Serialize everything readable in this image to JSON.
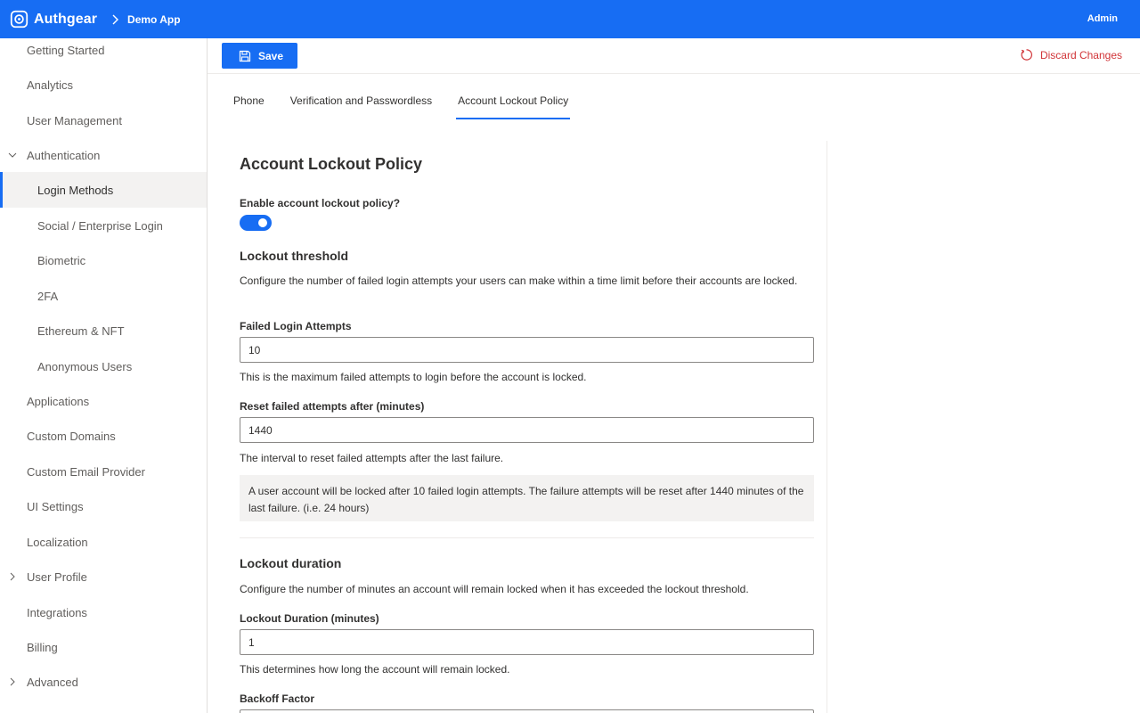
{
  "topbar": {
    "brand": "Authgear",
    "app": "Demo App",
    "user": "Admin"
  },
  "sidebar": {
    "items": [
      {
        "label": "Getting Started"
      },
      {
        "label": "Analytics"
      },
      {
        "label": "User Management"
      },
      {
        "label": "Authentication",
        "expanded": true
      },
      {
        "label": "Login Methods",
        "active": true
      },
      {
        "label": "Social / Enterprise Login"
      },
      {
        "label": "Biometric"
      },
      {
        "label": "2FA"
      },
      {
        "label": "Ethereum & NFT"
      },
      {
        "label": "Anonymous Users"
      },
      {
        "label": "Applications"
      },
      {
        "label": "Custom Domains"
      },
      {
        "label": "Custom Email Provider"
      },
      {
        "label": "UI Settings"
      },
      {
        "label": "Localization"
      },
      {
        "label": "User Profile",
        "expandable": true
      },
      {
        "label": "Integrations"
      },
      {
        "label": "Billing"
      },
      {
        "label": "Advanced",
        "expandable": true
      }
    ]
  },
  "toolbar": {
    "save_label": "Save",
    "discard_label": "Discard Changes"
  },
  "tabs": [
    {
      "label": "Phone"
    },
    {
      "label": "Verification and Passwordless"
    },
    {
      "label": "Account Lockout Policy",
      "active": true
    }
  ],
  "main": {
    "title": "Account Lockout Policy",
    "enable_label": "Enable account lockout policy?",
    "enable_value": true,
    "threshold": {
      "title": "Lockout threshold",
      "description": "Configure the number of failed login attempts your users can make within a time limit before their accounts are locked.",
      "attempts_label": "Failed Login Attempts",
      "attempts_value": "10",
      "attempts_help": "This is the maximum failed attempts to login before the account is locked.",
      "reset_label": "Reset failed attempts after (minutes)",
      "reset_value": "1440",
      "reset_help": "The interval to reset failed attempts after the last failure.",
      "summary": "A user account will be locked after 10 failed login attempts. The failure attempts will be reset after 1440 minutes of the last failure. (i.e. 24 hours)"
    },
    "duration": {
      "title": "Lockout duration",
      "description": "Configure the number of minutes an account will remain locked when it has exceeded the lockout threshold.",
      "duration_label": "Lockout Duration (minutes)",
      "duration_value": "1",
      "duration_help": "This determines how long the account will remain locked.",
      "backoff_label": "Backoff Factor"
    }
  },
  "colors": {
    "brand": "#176df3",
    "danger": "#d13438",
    "border": "#8a8886"
  }
}
